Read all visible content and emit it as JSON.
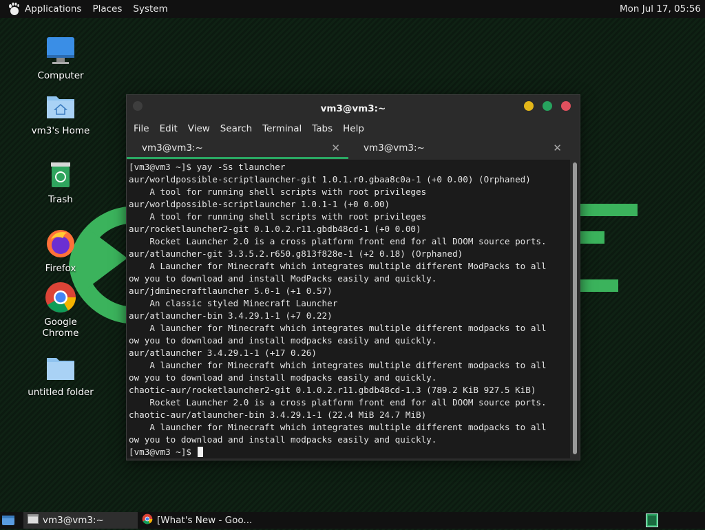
{
  "top_panel": {
    "menus": [
      "Applications",
      "Places",
      "System"
    ],
    "clock": "Mon Jul 17, 05:56"
  },
  "desktop": {
    "icons": [
      {
        "label": "Computer",
        "icon": "computer-icon"
      },
      {
        "label": "vm3's Home",
        "icon": "home-folder-icon"
      },
      {
        "label": "Trash",
        "icon": "trash-icon"
      },
      {
        "label": "Firefox",
        "icon": "firefox-icon"
      },
      {
        "label": "Google Chrome",
        "icon": "chrome-icon"
      },
      {
        "label": "untitled folder",
        "icon": "folder-icon"
      }
    ]
  },
  "terminal": {
    "title": "vm3@vm3:~",
    "menus": [
      "File",
      "Edit",
      "View",
      "Search",
      "Terminal",
      "Tabs",
      "Help"
    ],
    "tabs": [
      {
        "label": "vm3@vm3:~",
        "active": true
      },
      {
        "label": "vm3@vm3:~",
        "active": false
      }
    ],
    "lines": [
      "[vm3@vm3 ~]$ yay -Ss tlauncher",
      "aur/worldpossible-scriptlauncher-git 1.0.1.r0.gbaa8c0a-1 (+0 0.00) (Orphaned)",
      "    A tool for running shell scripts with root privileges",
      "aur/worldpossible-scriptlauncher 1.0.1-1 (+0 0.00)",
      "    A tool for running shell scripts with root privileges",
      "aur/rocketlauncher2-git 0.1.0.2.r11.gbdb48cd-1 (+0 0.00)",
      "    Rocket Launcher 2.0 is a cross platform front end for all DOOM source ports.",
      "aur/atlauncher-git 3.3.5.2.r650.g813f828e-1 (+2 0.18) (Orphaned)",
      "    A Launcher for Minecraft which integrates multiple different ModPacks to all",
      "ow you to download and install ModPacks easily and quickly.",
      "aur/jdminecraftlauncher 5.0-1 (+1 0.57)",
      "    An classic styled Minecraft Launcher",
      "aur/atlauncher-bin 3.4.29.1-1 (+7 0.22)",
      "    A launcher for Minecraft which integrates multiple different modpacks to all",
      "ow you to download and install modpacks easily and quickly.",
      "aur/atlauncher 3.4.29.1-1 (+17 0.26)",
      "    A launcher for Minecraft which integrates multiple different modpacks to all",
      "ow you to download and install modpacks easily and quickly.",
      "chaotic-aur/rocketlauncher2-git 0.1.0.2.r11.gbdb48cd-1.3 (789.2 KiB 927.5 KiB)",
      "    Rocket Launcher 2.0 is a cross platform front end for all DOOM source ports.",
      "chaotic-aur/atlauncher-bin 3.4.29.1-1 (22.4 MiB 24.7 MiB)",
      "    A launcher for Minecraft which integrates multiple different modpacks to all",
      "ow you to download and install modpacks easily and quickly."
    ],
    "prompt": "[vm3@vm3 ~]$ "
  },
  "taskbar": {
    "items": [
      {
        "label": "vm3@vm3:~",
        "icon": "terminal-window-icon"
      },
      {
        "label": "[What's New - Goo...",
        "icon": "chrome-icon"
      }
    ]
  },
  "colors": {
    "accent_green": "#2aa863",
    "close_red": "#e0505e",
    "min_yellow": "#e3b619",
    "max_green": "#27a35e"
  }
}
